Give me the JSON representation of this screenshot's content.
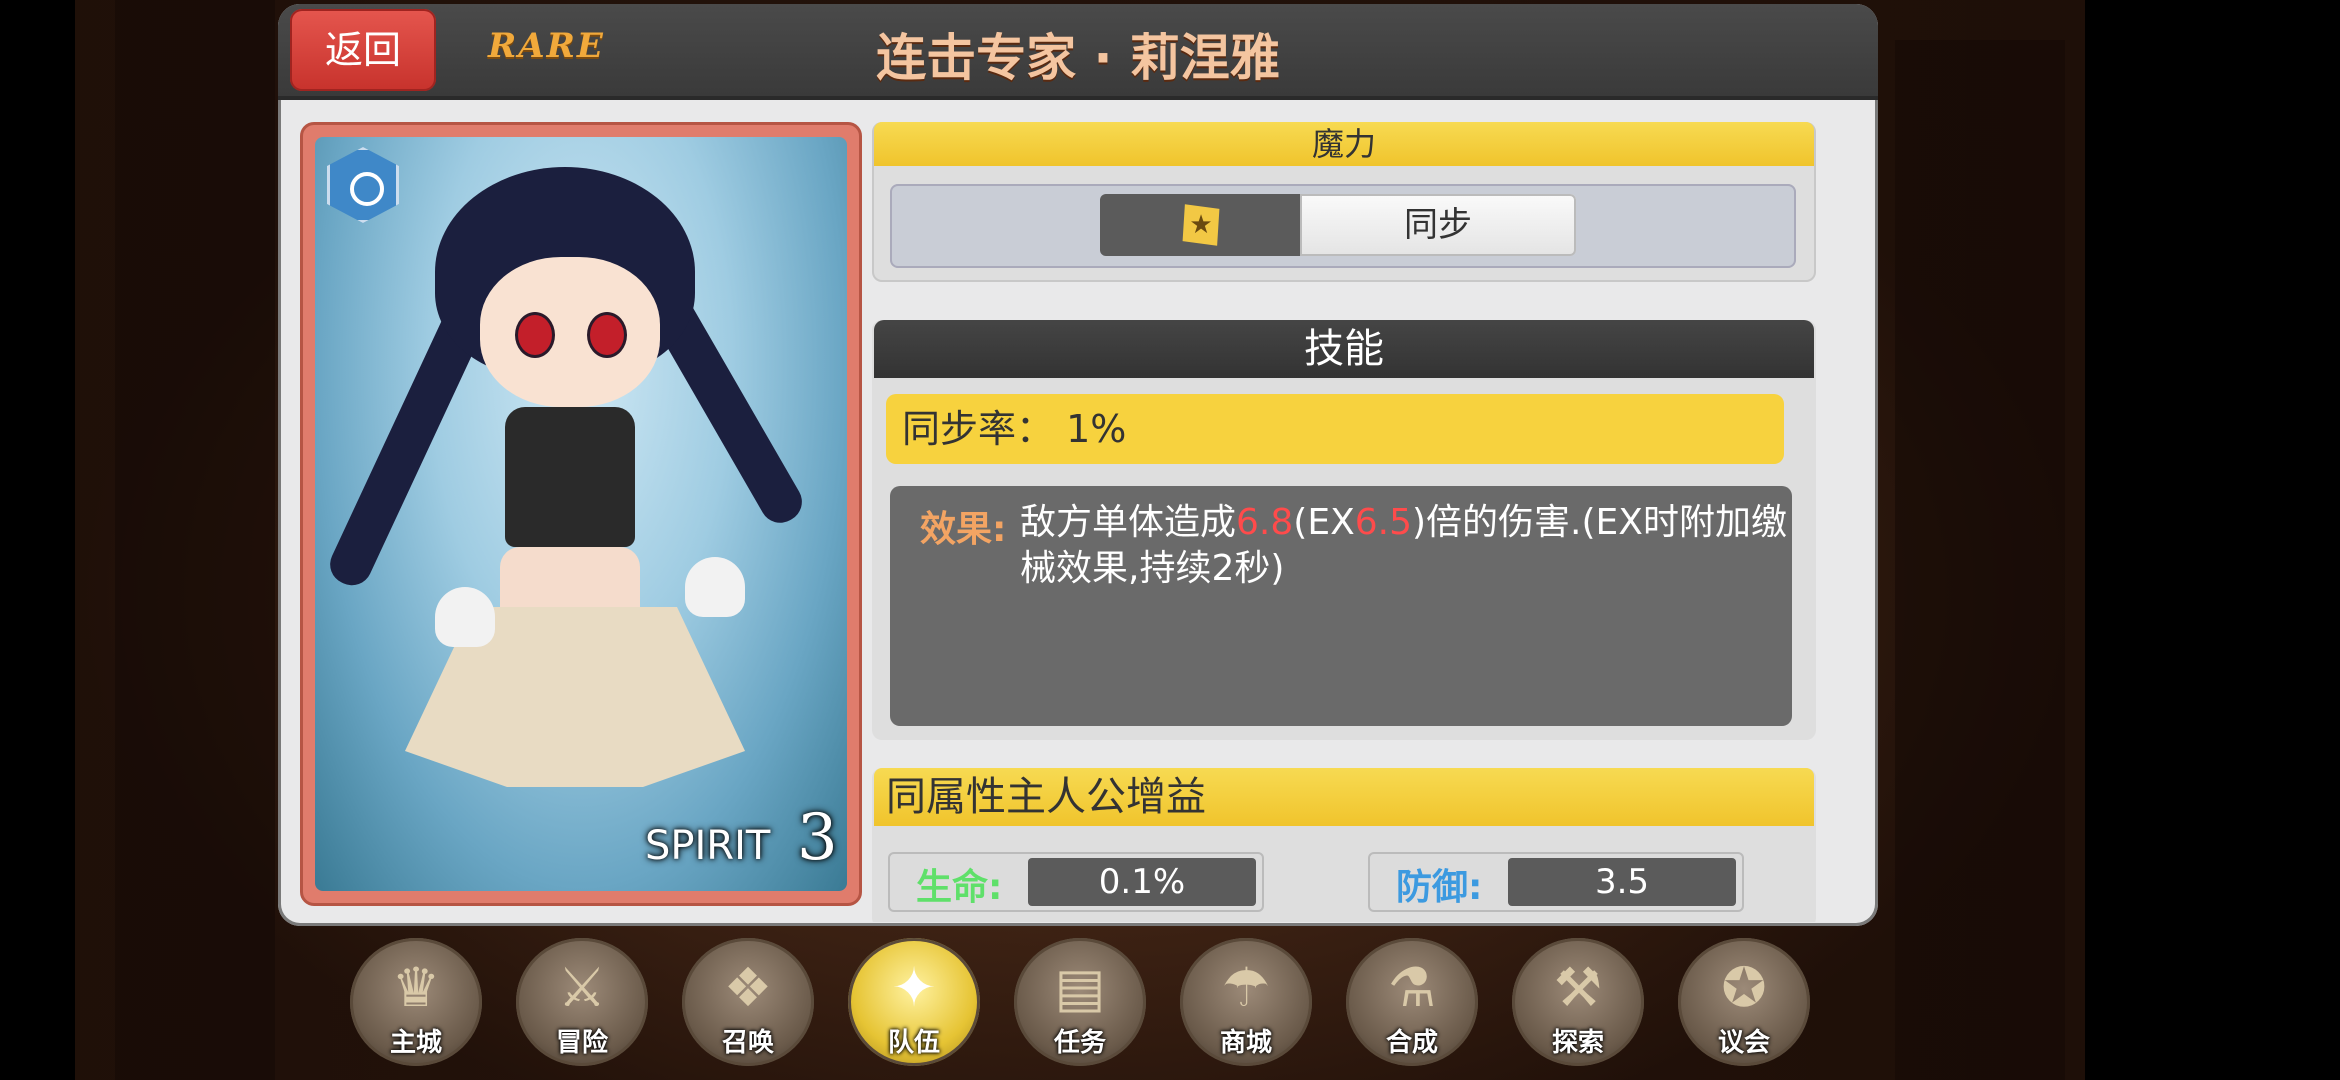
{
  "window": {
    "back_label": "返回",
    "rarity": "RARE",
    "title": "连击专家 · 莉涅雅"
  },
  "card": {
    "attribute_icon": "spirit-shield-icon",
    "label": "SPIRIT",
    "level": "3"
  },
  "mana": {
    "header": "魔力",
    "upgrade_icon": "star-up-icon",
    "sync_label": "同步"
  },
  "skill": {
    "header": "技能",
    "sync_rate_label": "同步率：",
    "sync_rate_value": "1%",
    "effect_label": "效果:",
    "effect_part1": "敌方单体造成",
    "effect_mult": "6.8",
    "effect_part2": "(EX",
    "effect_ex_mult": "6.5",
    "effect_part3": ")倍的伤害.(EX时附加缴械效果,持续2秒)"
  },
  "buff": {
    "header": "同属性主人公增益",
    "hp_label": "生命:",
    "hp_value": "0.1%",
    "def_label": "防御:",
    "def_value": "3.5"
  },
  "colors": {
    "hp_label": "#5fe06a",
    "def_label": "#3c9ae0"
  },
  "nav": [
    {
      "label": "主城",
      "icon": "crown-icon",
      "glyph": "♛"
    },
    {
      "label": "冒险",
      "icon": "crossed-axes-icon",
      "glyph": "⚔"
    },
    {
      "label": "召唤",
      "icon": "summon-cards-icon",
      "glyph": "❖"
    },
    {
      "label": "队伍",
      "icon": "winged-emblem-icon",
      "glyph": "✦",
      "active": true
    },
    {
      "label": "任务",
      "icon": "quest-book-icon",
      "glyph": "▤"
    },
    {
      "label": "商城",
      "icon": "shop-icon",
      "glyph": "☂"
    },
    {
      "label": "合成",
      "icon": "synthesis-icon",
      "glyph": "⚗"
    },
    {
      "label": "探索",
      "icon": "explore-tools-icon",
      "glyph": "⚒"
    },
    {
      "label": "议会",
      "icon": "council-icon",
      "glyph": "✪"
    }
  ]
}
